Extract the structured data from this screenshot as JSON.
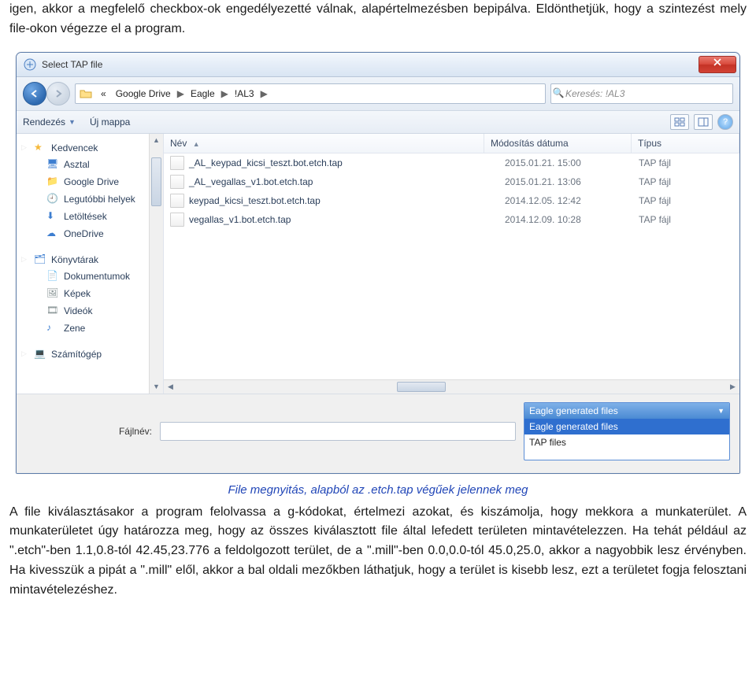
{
  "doc": {
    "para_top": "igen, akkor a megfelelő checkbox-ok engedélyezetté válnak, alapértelmezésben bepipálva. Eldönthetjük, hogy a szintezést mely file-okon végezze el a program.",
    "caption": "File megnyitás, alapból az .etch.tap végűek jelennek meg",
    "para_bottom": "A file kiválasztásakor a program felolvassa a g-kódokat, értelmezi azokat, és kiszámolja, hogy mekkora a munkaterület. A munkaterületet úgy határozza meg, hogy az összes kiválasztott file által lefedett területen mintavételezzen. Ha tehát például az \".etch\"-ben 1.1,0.8-tól 42.45,23.776 a feldolgozott terület, de a \".mill\"-ben 0.0,0.0-tól 45.0,25.0, akkor a nagyobbik lesz érvényben. Ha kivesszük a pipát a \".mill\" elől, akkor a bal oldali mezőkben láthatjuk, hogy a terület is kisebb lesz, ezt a területet fogja felosztani mintavételezéshez."
  },
  "dialog": {
    "title": "Select TAP file",
    "breadcrumb": {
      "prefix": "«",
      "seg1": "Google Drive",
      "seg2": "Eagle",
      "seg3": "!AL3"
    },
    "search_placeholder": "Keresés: !AL3",
    "toolbar": {
      "organize": "Rendezés",
      "new_folder": "Új mappa"
    },
    "sidebar": {
      "favorites": "Kedvencek",
      "desktop": "Asztal",
      "gdrive": "Google Drive",
      "recent": "Legutóbbi helyek",
      "downloads": "Letöltések",
      "onedrive": "OneDrive",
      "libraries": "Könyvtárak",
      "documents": "Dokumentumok",
      "pictures": "Képek",
      "videos": "Videók",
      "music": "Zene",
      "computer": "Számítógép"
    },
    "columns": {
      "name": "Név",
      "date": "Módosítás dátuma",
      "type": "Típus"
    },
    "files": [
      {
        "name": "_AL_keypad_kicsi_teszt.bot.etch.tap",
        "date": "2015.01.21. 15:00",
        "type": "TAP fájl"
      },
      {
        "name": "_AL_vegallas_v1.bot.etch.tap",
        "date": "2015.01.21. 13:06",
        "type": "TAP fájl"
      },
      {
        "name": "keypad_kicsi_teszt.bot.etch.tap",
        "date": "2014.12.05. 12:42",
        "type": "TAP fájl"
      },
      {
        "name": "vegallas_v1.bot.etch.tap",
        "date": "2014.12.09. 10:28",
        "type": "TAP fájl"
      }
    ],
    "footer": {
      "filename_label": "Fájlnév:",
      "filetype_selected": "Eagle generated files",
      "filetype_options": [
        "Eagle generated files",
        "TAP files"
      ]
    }
  }
}
